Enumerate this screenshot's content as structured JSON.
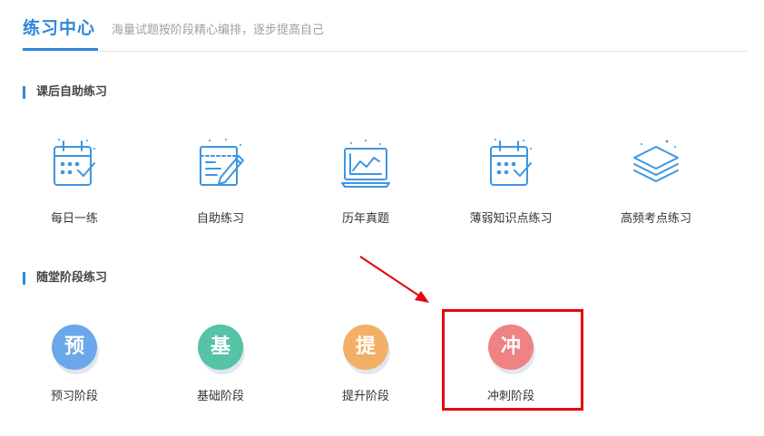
{
  "header": {
    "title": "练习中心",
    "subtitle": "海量试题按阶段精心编排，逐步提高自己",
    "accent": "#2f87d8"
  },
  "section1": {
    "title": "课后自助练习",
    "items": [
      {
        "label": "每日一练",
        "icon": "calendar-check-icon"
      },
      {
        "label": "自助练习",
        "icon": "document-pen-icon"
      },
      {
        "label": "历年真题",
        "icon": "monitor-chart-icon"
      },
      {
        "label": "薄弱知识点练习",
        "icon": "calendar-check-icon"
      },
      {
        "label": "高频考点练习",
        "icon": "layers-icon"
      }
    ]
  },
  "section2": {
    "title": "随堂阶段练习",
    "items": [
      {
        "label": "预习阶段",
        "char": "预",
        "color": "#6aa8ea"
      },
      {
        "label": "基础阶段",
        "char": "基",
        "color": "#56c3a6"
      },
      {
        "label": "提升阶段",
        "char": "提",
        "color": "#f2b067"
      },
      {
        "label": "冲刺阶段",
        "char": "冲",
        "color": "#ef8383"
      }
    ]
  },
  "annotation": {
    "highlight_color": "#e60012"
  }
}
